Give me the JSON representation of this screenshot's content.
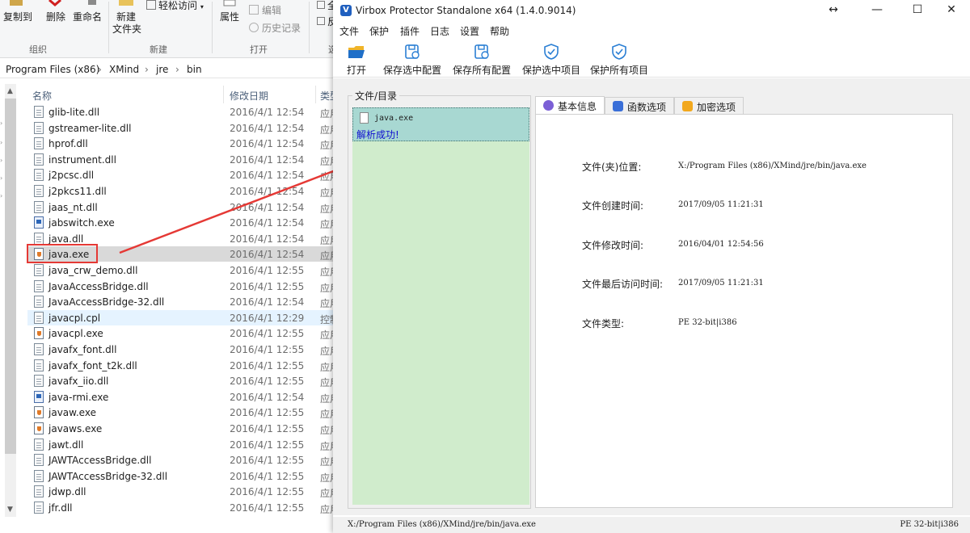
{
  "explorer": {
    "ribbon": {
      "copy_to": "复制到",
      "delete": "删除",
      "rename": "重命名",
      "new_folder_1": "新建",
      "new_folder_2": "文件夹",
      "easy_access": "轻松访问",
      "properties": "属性",
      "edit": "编辑",
      "history": "历史记录",
      "group_organize": "组织",
      "group_new": "新建",
      "group_open": "打开",
      "select_all_partial": "全",
      "invert_partial": "反",
      "select_partial": "选"
    },
    "address": [
      "Program Files (x86)",
      "XMind",
      "jre",
      "bin"
    ],
    "columns": {
      "name": "名称",
      "date": "修改日期",
      "type": "类型"
    },
    "files": [
      {
        "name": "glib-lite.dll",
        "date": "2016/4/1 12:54",
        "type": "应用",
        "icon": "dll"
      },
      {
        "name": "gstreamer-lite.dll",
        "date": "2016/4/1 12:54",
        "type": "应用",
        "icon": "dll"
      },
      {
        "name": "hprof.dll",
        "date": "2016/4/1 12:54",
        "type": "应用",
        "icon": "dll"
      },
      {
        "name": "instrument.dll",
        "date": "2016/4/1 12:54",
        "type": "应用",
        "icon": "dll"
      },
      {
        "name": "j2pcsc.dll",
        "date": "2016/4/1 12:54",
        "type": "应用",
        "icon": "dll"
      },
      {
        "name": "j2pkcs11.dll",
        "date": "2016/4/1 12:54",
        "type": "应用",
        "icon": "dll"
      },
      {
        "name": "jaas_nt.dll",
        "date": "2016/4/1 12:54",
        "type": "应用",
        "icon": "dll"
      },
      {
        "name": "jabswitch.exe",
        "date": "2016/4/1 12:54",
        "type": "应用",
        "icon": "exe"
      },
      {
        "name": "java.dll",
        "date": "2016/4/1 12:54",
        "type": "应用",
        "icon": "dll"
      },
      {
        "name": "java.exe",
        "date": "2016/4/1 12:54",
        "type": "应用",
        "icon": "java",
        "state": "sel"
      },
      {
        "name": "java_crw_demo.dll",
        "date": "2016/4/1 12:55",
        "type": "应用",
        "icon": "dll"
      },
      {
        "name": "JavaAccessBridge.dll",
        "date": "2016/4/1 12:55",
        "type": "应用",
        "icon": "dll"
      },
      {
        "name": "JavaAccessBridge-32.dll",
        "date": "2016/4/1 12:54",
        "type": "应用",
        "icon": "dll"
      },
      {
        "name": "javacpl.cpl",
        "date": "2016/4/1 12:29",
        "type": "控制",
        "icon": "dll",
        "state": "hov"
      },
      {
        "name": "javacpl.exe",
        "date": "2016/4/1 12:55",
        "type": "应用",
        "icon": "java"
      },
      {
        "name": "javafx_font.dll",
        "date": "2016/4/1 12:55",
        "type": "应用",
        "icon": "dll"
      },
      {
        "name": "javafx_font_t2k.dll",
        "date": "2016/4/1 12:55",
        "type": "应用",
        "icon": "dll"
      },
      {
        "name": "javafx_iio.dll",
        "date": "2016/4/1 12:55",
        "type": "应用",
        "icon": "dll"
      },
      {
        "name": "java-rmi.exe",
        "date": "2016/4/1 12:54",
        "type": "应用",
        "icon": "exe"
      },
      {
        "name": "javaw.exe",
        "date": "2016/4/1 12:55",
        "type": "应用",
        "icon": "java"
      },
      {
        "name": "javaws.exe",
        "date": "2016/4/1 12:55",
        "type": "应用",
        "icon": "java"
      },
      {
        "name": "jawt.dll",
        "date": "2016/4/1 12:55",
        "type": "应用",
        "icon": "dll"
      },
      {
        "name": "JAWTAccessBridge.dll",
        "date": "2016/4/1 12:55",
        "type": "应用",
        "icon": "dll"
      },
      {
        "name": "JAWTAccessBridge-32.dll",
        "date": "2016/4/1 12:55",
        "type": "应用",
        "icon": "dll"
      },
      {
        "name": "jdwp.dll",
        "date": "2016/4/1 12:55",
        "type": "应用",
        "icon": "dll"
      },
      {
        "name": "jfr.dll",
        "date": "2016/4/1 12:55",
        "type": "应用",
        "icon": "dll"
      }
    ]
  },
  "virbox": {
    "title": "Virbox Protector Standalone x64  (1.4.0.9014)",
    "logo_letter": "V",
    "window_buttons": {
      "resize": "↔",
      "minimize": "—",
      "maximize": "☐",
      "close": "✕"
    },
    "menu": [
      "文件",
      "保护",
      "插件",
      "日志",
      "设置",
      "帮助"
    ],
    "toolbar": [
      "打开",
      "保存选中配置",
      "保存所有配置",
      "保护选中项目",
      "保护所有项目"
    ],
    "file_group_title": "文件/目录",
    "file_item": {
      "name": "java.exe",
      "status": "解析成功!"
    },
    "tabs": [
      "基本信息",
      "函数选项",
      "加密选项"
    ],
    "info": [
      {
        "label": "文件(夹)位置:",
        "value": "X:/Program Files (x86)/XMind/jre/bin/java.exe"
      },
      {
        "label": "文件创建时间:",
        "value": "2017/09/05 11:21:31"
      },
      {
        "label": "文件修改时间:",
        "value": "2016/04/01 12:54:56"
      },
      {
        "label": "文件最后访问时间:",
        "value": "2017/09/05 11:21:31"
      },
      {
        "label": "文件类型:",
        "value": "PE 32-bit|i386"
      }
    ],
    "status": {
      "path": "X:/Program Files (x86)/XMind/jre/bin/java.exe",
      "type": "PE 32-bit|i386"
    },
    "colors": {
      "tree_bg": "#d0eccc",
      "tree_selected": "#a8d8d2",
      "status_blue": "#1010d0",
      "annotation_red": "#e53935"
    }
  }
}
